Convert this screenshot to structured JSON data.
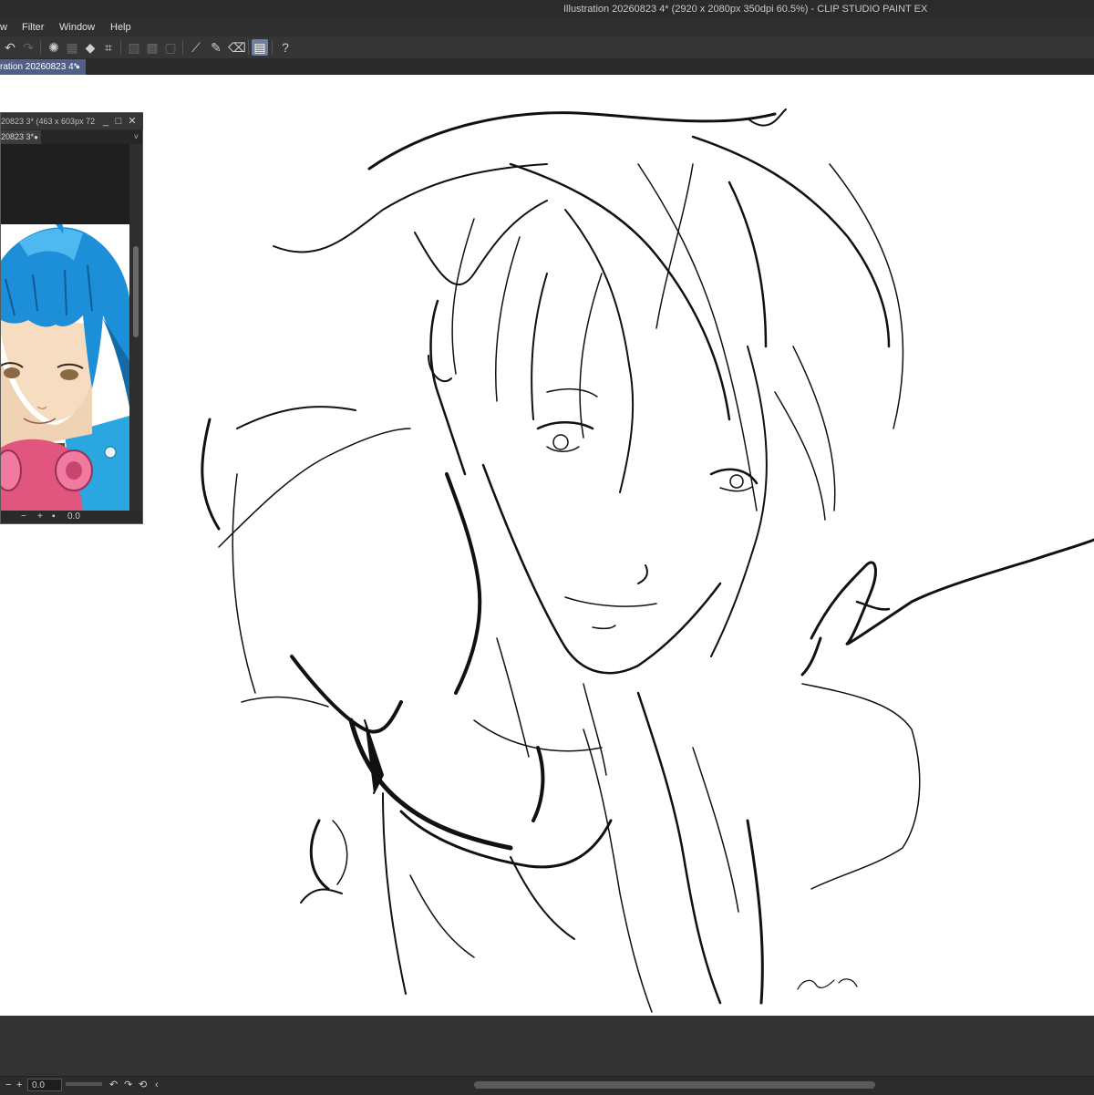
{
  "window": {
    "title": "Illustration 20260823 4* (2920 x 2080px 350dpi 60.5%)  - CLIP STUDIO PAINT EX"
  },
  "menu": {
    "items": [
      "w",
      "Filter",
      "Window",
      "Help"
    ]
  },
  "toolbar": {
    "icons": [
      "undo-icon",
      "redo-icon",
      "select-all-icon",
      "clear-selection-icon",
      "fill-icon",
      "transform-icon",
      "ruler-icon",
      "brush-icon",
      "eraser-icon",
      "page-icon",
      "help-icon"
    ]
  },
  "tabs": {
    "active_label": "ration 20260823 4*",
    "close_glyph": "●"
  },
  "subview": {
    "title": "20823 3* (463 x 603px 72",
    "tab_label": "20823 3*",
    "tab_dot": "●",
    "chevron": "˅",
    "minimize": "_",
    "maximize": "□",
    "close": "✕",
    "zoom_value": "0.0",
    "minus": "−",
    "plus": "+"
  },
  "canvas": {
    "signature_text": "Aoba",
    "small_signature": "ヤKLLATI"
  },
  "statusbar": {
    "zoom_value": "0.0"
  },
  "colors": {
    "tab_active": "#4f5f86",
    "canvas": "#ffffff",
    "ui_dark": "#2b2b2b"
  }
}
